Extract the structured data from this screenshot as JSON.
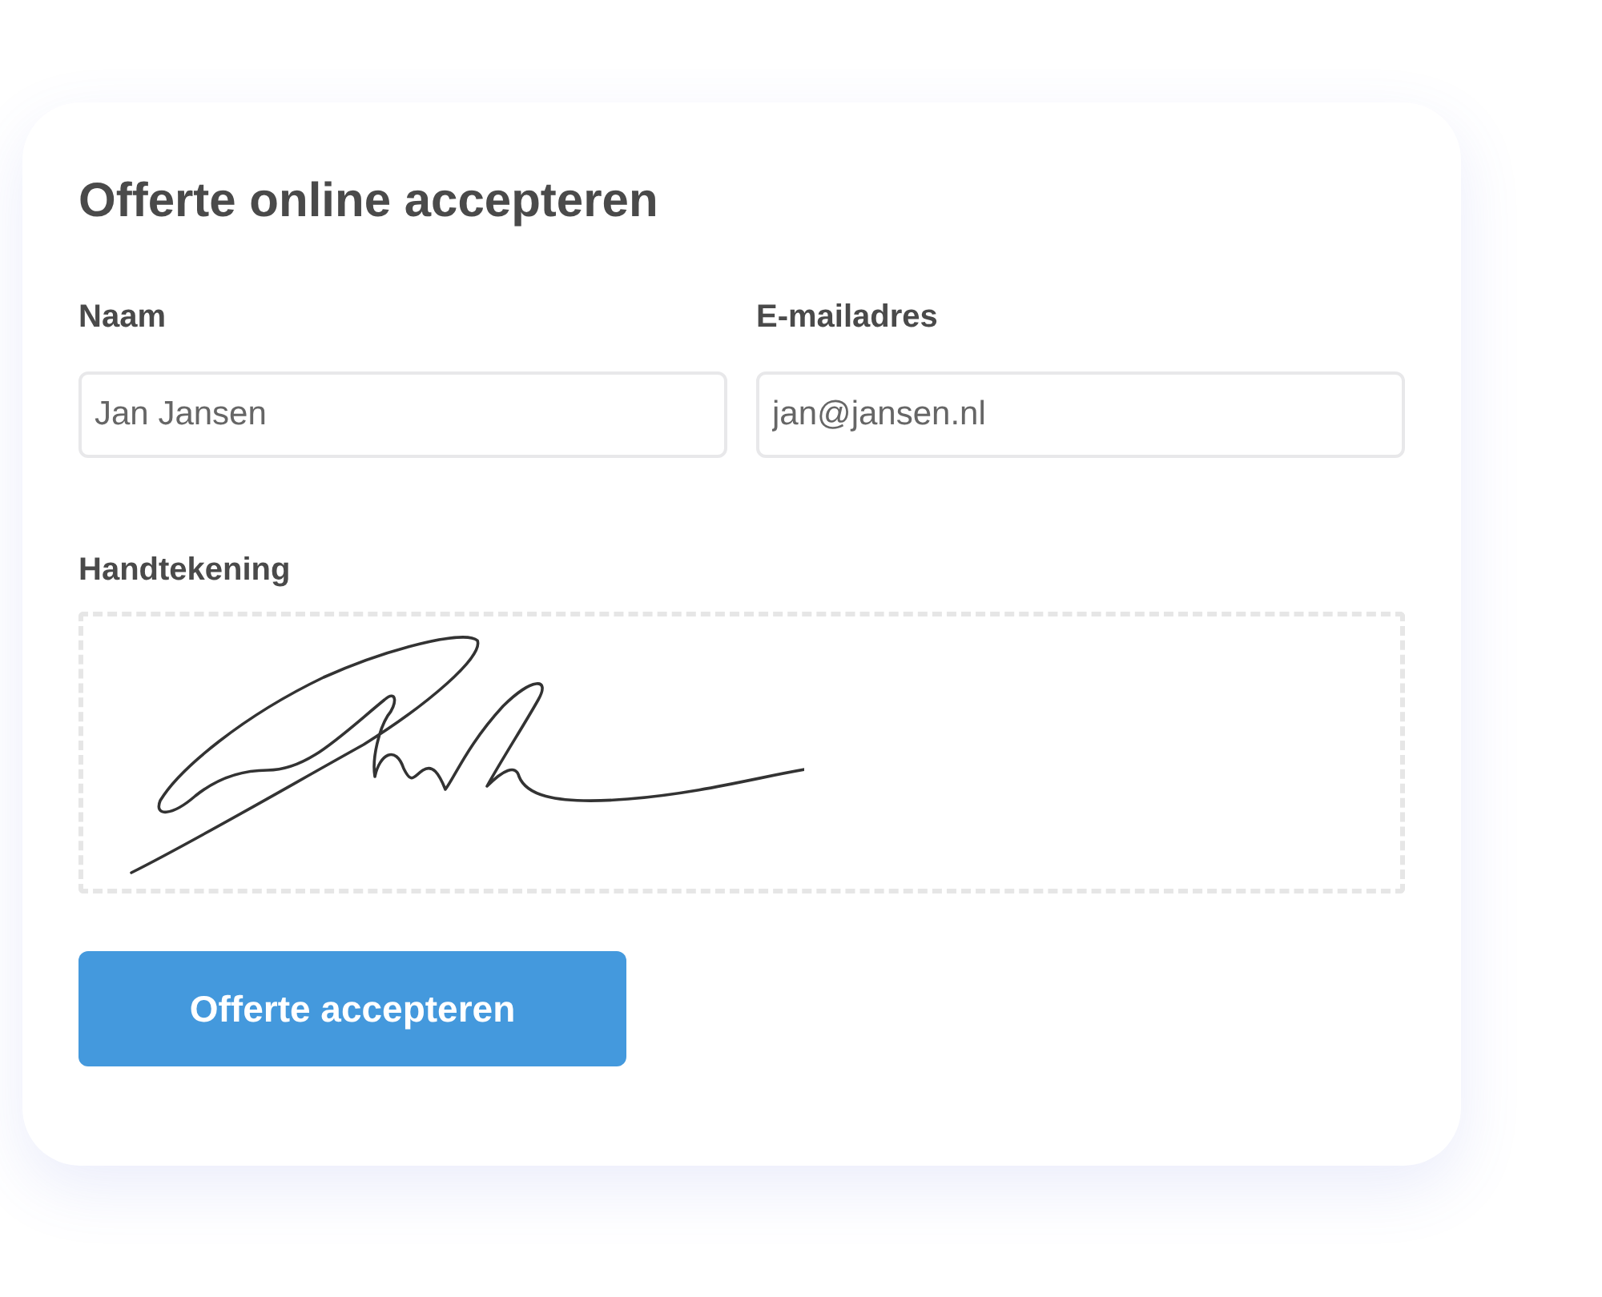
{
  "title": "Offerte online accepteren",
  "fields": [
    {
      "label": "Naam",
      "value": "Jan Jansen"
    },
    {
      "label": "E-mailadres",
      "value": "jan@jansen.nl"
    }
  ],
  "signature": {
    "label": "Handtekening"
  },
  "submit_button": "Offerte accepteren"
}
